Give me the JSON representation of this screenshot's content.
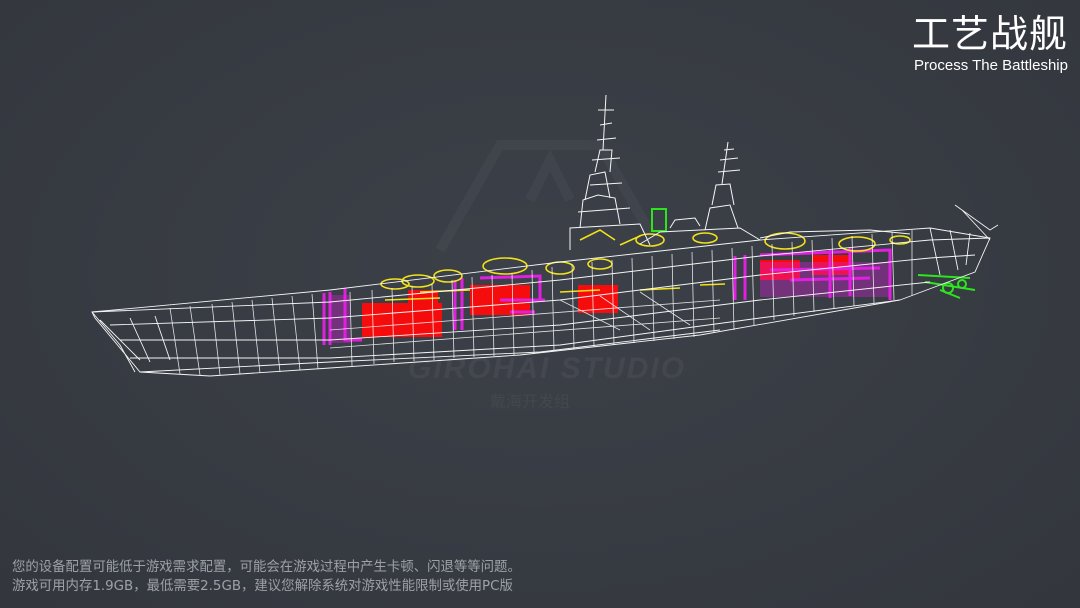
{
  "title": "工艺战舰",
  "subtitle": "Process The Battleship",
  "watermark": {
    "studio": "GIROHAI STUDIO",
    "team": "戴海开发组"
  },
  "warning": {
    "line1": "您的设备配置可能低于游戏需求配置，可能会在游戏过程中产生卡顿、闪退等等问题。",
    "line2": "游戏可用内存1.9GB，最低需要2.5GB，建议您解除系统对游戏性能限制或使用PC版"
  },
  "colors": {
    "background": "#373b42",
    "wireframe": "#ffffff",
    "armor": "#ff0a0a",
    "bulkhead": "#e020e0",
    "machinery": "#f2e21a",
    "anchor_gear": "#2ce61c"
  }
}
